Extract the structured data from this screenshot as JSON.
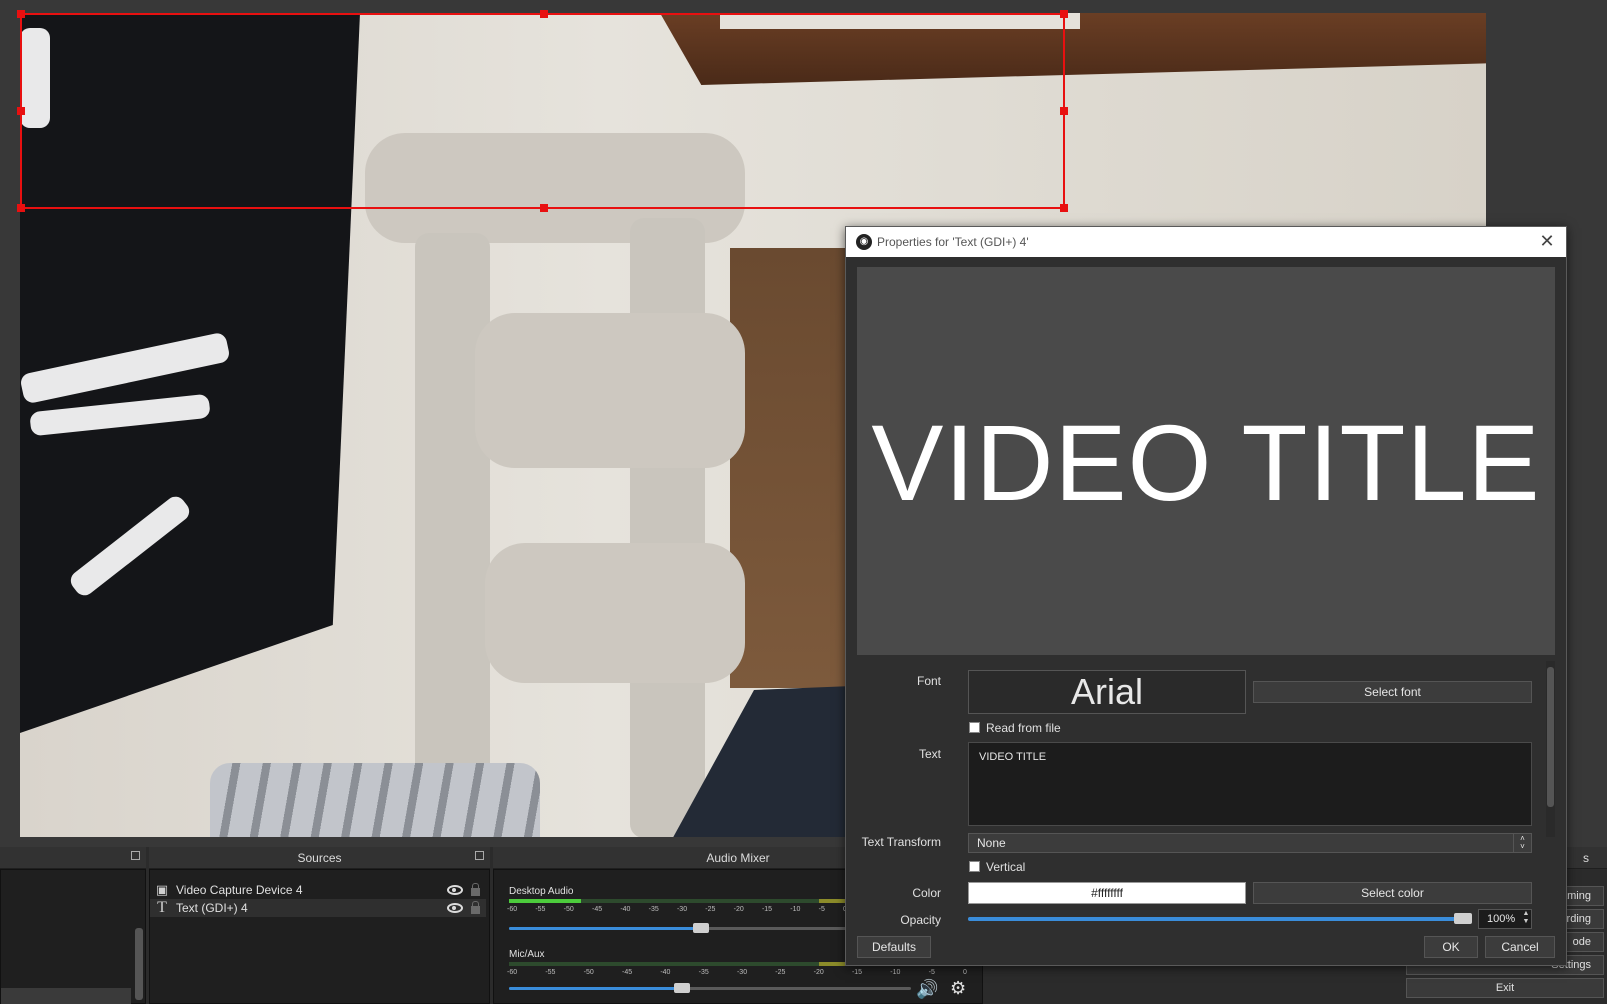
{
  "dialog": {
    "title": "Properties for 'Text (GDI+) 4'",
    "close_glyph": "✕",
    "preview_text": "VIDEO TITLE",
    "font_label": "Font",
    "font_value": "Arial",
    "select_font_label": "Select font",
    "read_from_file_label": "Read from file",
    "read_from_file_checked": false,
    "text_label": "Text",
    "text_value": "VIDEO TITLE",
    "transform_label": "Text Transform",
    "transform_value": "None",
    "vertical_label": "Vertical",
    "vertical_checked": false,
    "color_label": "Color",
    "color_value": "#ffffffff",
    "select_color_label": "Select color",
    "opacity_label": "Opacity",
    "opacity_value": "100%",
    "opacity_fraction": 1.0,
    "defaults_label": "Defaults",
    "ok_label": "OK",
    "cancel_label": "Cancel"
  },
  "docks": {
    "sources_title": "Sources",
    "mixer_title": "Audio Mixer",
    "controls_title_partial": "s",
    "sources": [
      {
        "name": "Video Capture Device 4",
        "icon": "camera-icon",
        "visible": true,
        "locked": false
      },
      {
        "name": "Text (GDI+) 4",
        "icon": "text-icon",
        "visible": true,
        "locked": false
      }
    ],
    "mixer": [
      {
        "name": "Desktop Audio",
        "fader_fraction": 0.48
      },
      {
        "name": "Mic/Aux",
        "fader_fraction": 0.43
      }
    ],
    "meter_ticks": [
      "-60",
      "-55",
      "-50",
      "-45",
      "-40",
      "-35",
      "-30",
      "-25",
      "-20",
      "-15",
      "-10",
      "-5",
      "0"
    ],
    "controls": [
      {
        "label": "aming"
      },
      {
        "label": "ording"
      },
      {
        "label": "ode"
      },
      {
        "label": "Settings"
      },
      {
        "label": "Exit"
      }
    ]
  },
  "colors": {
    "selection": "#e81010",
    "accent": "#3a8ddb",
    "meter_green": "#4ccc3c"
  }
}
